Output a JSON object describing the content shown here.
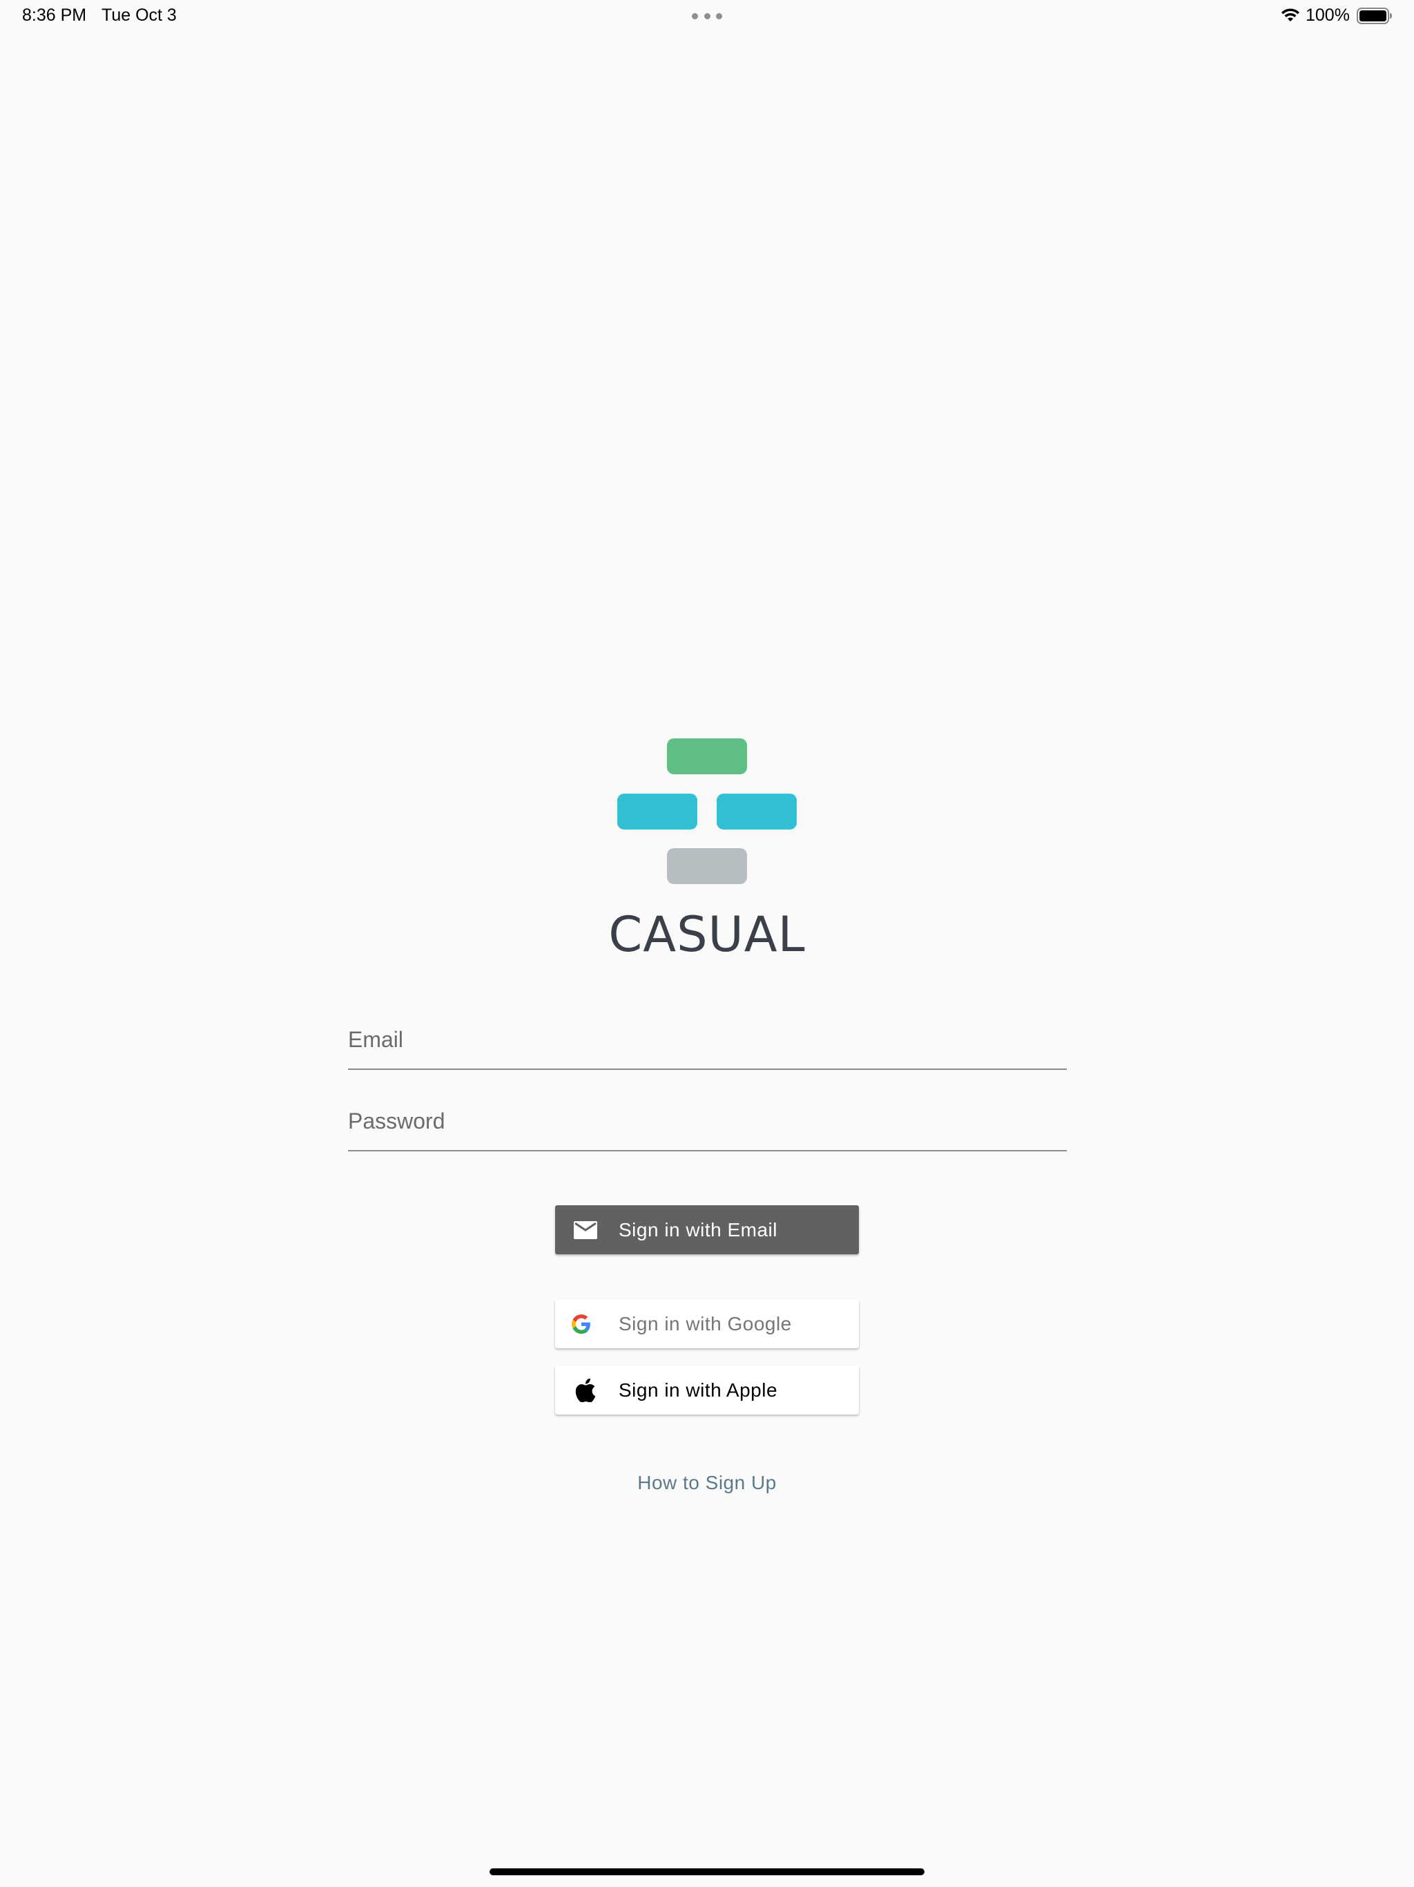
{
  "status_bar": {
    "time": "8:36 PM",
    "date": "Tue Oct 3",
    "battery_percent": "100%",
    "icons": [
      "more-dots-icon",
      "wifi-icon",
      "battery-icon"
    ]
  },
  "brand": {
    "name": "CASUAL",
    "logo_colors": {
      "top": "#5fbf86",
      "middle": "#33c0d6",
      "bottom": "#b6bec2"
    }
  },
  "form": {
    "email_placeholder": "Email",
    "email_value": "",
    "password_placeholder": "Password",
    "password_value": ""
  },
  "buttons": {
    "email": {
      "label": "Sign in with Email",
      "icon": "mail-icon",
      "color": "#616161"
    },
    "google": {
      "label": "Sign in with Google",
      "icon": "google-icon",
      "color": "#ffffff"
    },
    "apple": {
      "label": "Sign in with Apple",
      "icon": "apple-icon",
      "color": "#ffffff"
    }
  },
  "links": {
    "signup": "How to Sign Up"
  }
}
